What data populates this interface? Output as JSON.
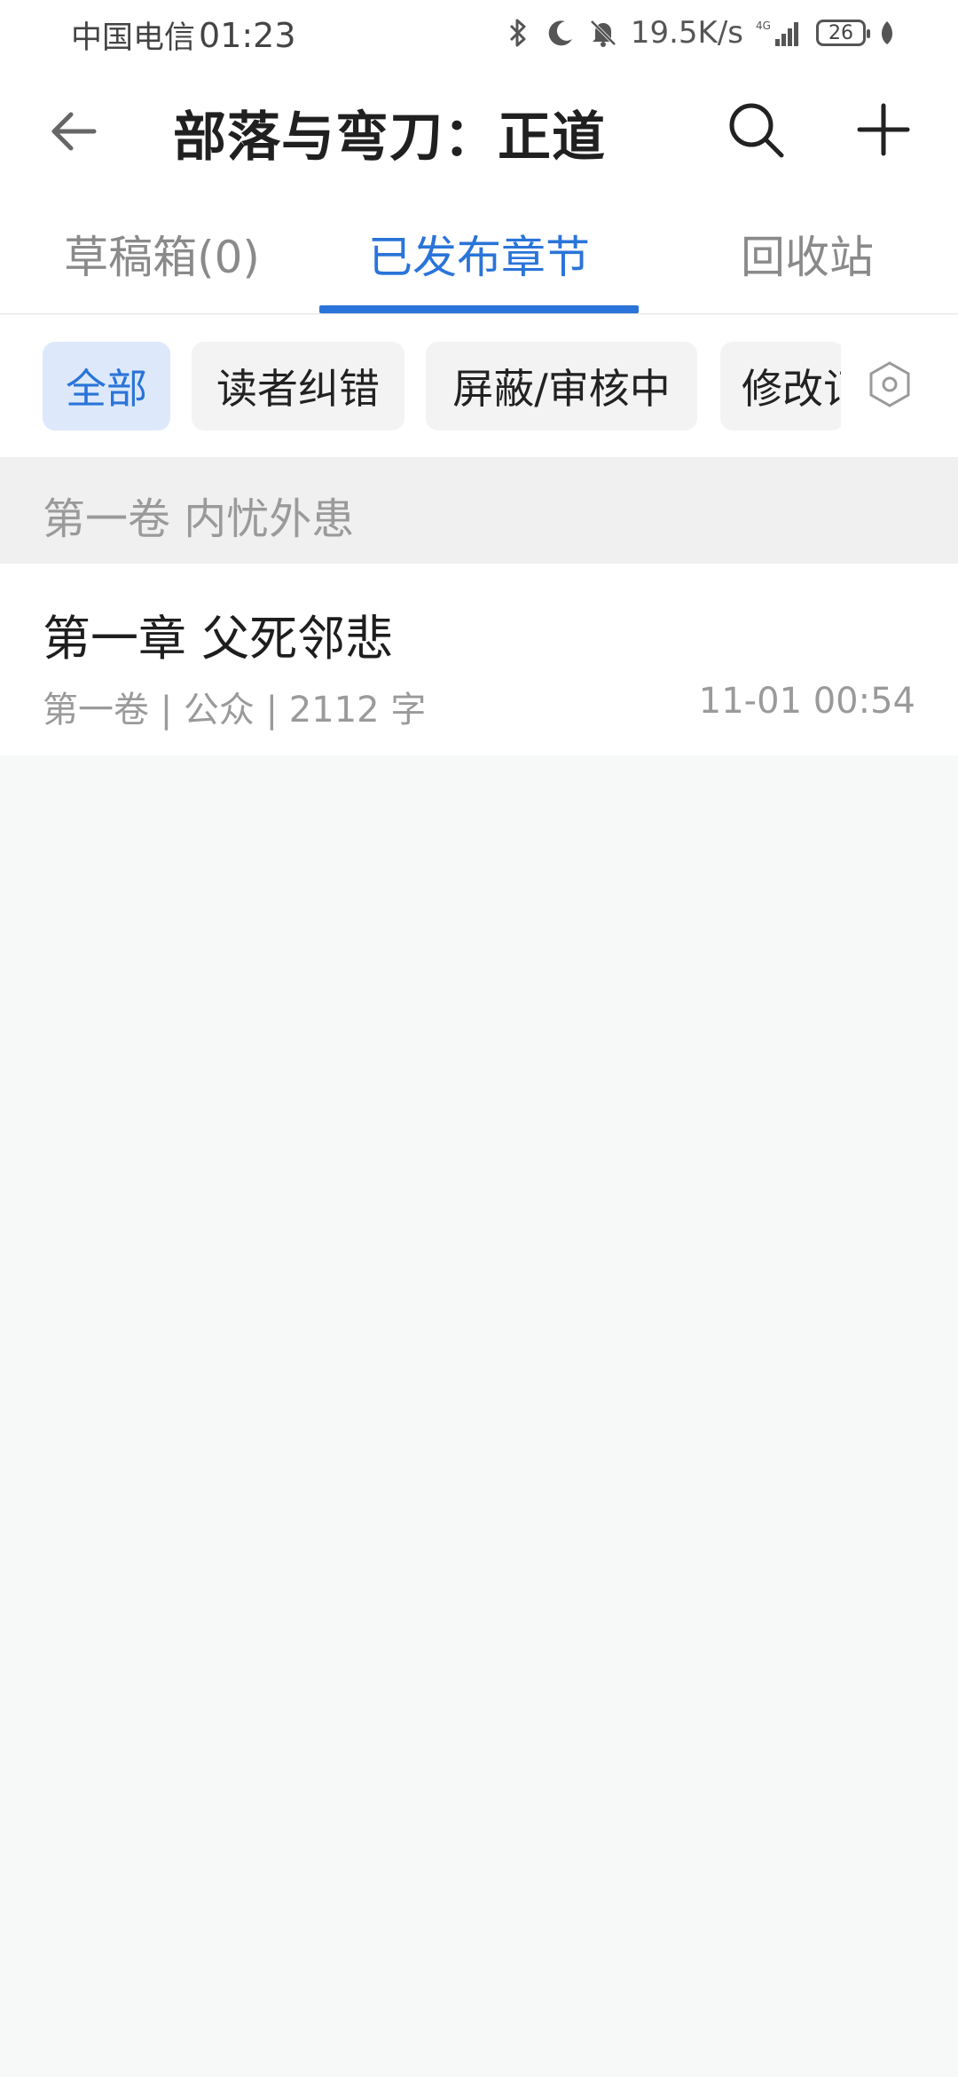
{
  "status_bar": {
    "carrier": "中国电信",
    "time": "01:23",
    "net_speed": "19.5K/s",
    "network_type": "4G",
    "battery": "26",
    "icons": [
      "bluetooth-icon",
      "moon-icon",
      "bell-off-icon",
      "signal-icon",
      "battery-icon",
      "leaf-icon"
    ]
  },
  "header": {
    "title": "部落与弯刀：正道"
  },
  "tabs": [
    {
      "label": "草稿箱(0)",
      "active": false
    },
    {
      "label": "已发布章节",
      "active": true
    },
    {
      "label": "回收站",
      "active": false
    }
  ],
  "filters": [
    {
      "label": "全部",
      "selected": true
    },
    {
      "label": "读者纠错",
      "selected": false
    },
    {
      "label": "屏蔽/审核中",
      "selected": false
    },
    {
      "label": "修改记",
      "selected": false
    }
  ],
  "volume": {
    "title": "第一卷 内忧外患"
  },
  "chapters": [
    {
      "title": "第一章 父死邻悲",
      "meta": "第一卷 | 公众 | 2112 字",
      "time": "11-01 00:54"
    }
  ],
  "colors": {
    "accent": "#2a74d9",
    "chip_selected_bg": "#dde9fb",
    "muted_text": "#9a9a9a"
  }
}
